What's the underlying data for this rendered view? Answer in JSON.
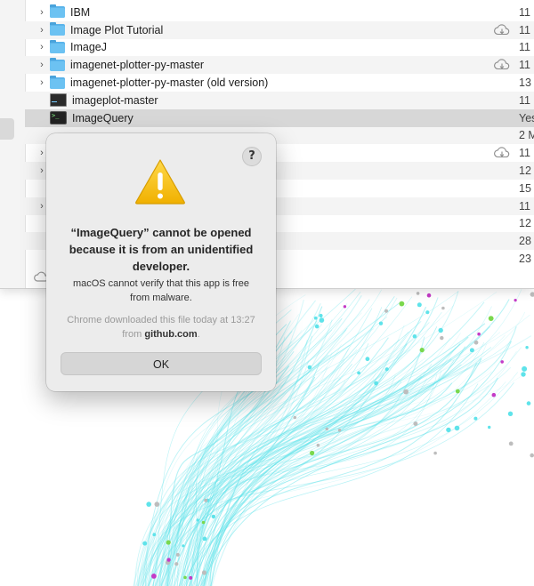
{
  "finder": {
    "rows": [
      {
        "name": "IBM",
        "icon": "folder-icon",
        "expandable": true,
        "cloud": false,
        "date": "11 I"
      },
      {
        "name": "Image Plot Tutorial",
        "icon": "folder-icon",
        "expandable": true,
        "cloud": true,
        "date": "11 I"
      },
      {
        "name": "ImageJ",
        "icon": "folder-icon",
        "expandable": true,
        "cloud": false,
        "date": "11 I"
      },
      {
        "name": "imagenet-plotter-py-master",
        "icon": "folder-icon",
        "expandable": true,
        "cloud": true,
        "date": "11 I"
      },
      {
        "name": "imagenet-plotter-py-master (old version)",
        "icon": "folder-icon",
        "expandable": true,
        "cloud": false,
        "date": "13"
      },
      {
        "name": "imageplot-master",
        "icon": "folder-icon",
        "expandable": false,
        "cloud": false,
        "date": "11 I"
      },
      {
        "name": "ImageQuery",
        "icon": "terminal-app-icon",
        "expandable": false,
        "cloud": false,
        "date": "Yes",
        "selected": true
      },
      {
        "name": "",
        "icon": "",
        "expandable": false,
        "cloud": false,
        "date": "2 M"
      },
      {
        "name": "",
        "icon": "",
        "expandable": true,
        "cloud": true,
        "date": "11 I"
      },
      {
        "name": "",
        "icon": "",
        "expandable": true,
        "cloud": false,
        "date": "12"
      },
      {
        "name": "",
        "icon": "",
        "expandable": false,
        "cloud": false,
        "date": "15"
      },
      {
        "name": "",
        "icon": "",
        "expandable": true,
        "cloud": false,
        "date": "11 I"
      },
      {
        "name": "",
        "icon": "",
        "expandable": false,
        "cloud": false,
        "date": "12"
      },
      {
        "name": "",
        "icon": "",
        "expandable": false,
        "cloud": false,
        "date": "28"
      },
      {
        "name": "",
        "icon": "",
        "expandable": false,
        "cloud": false,
        "date": "23"
      }
    ]
  },
  "alert": {
    "help_label": "?",
    "icon": "warning-triangle-icon",
    "title": "“ImageQuery” cannot be opened because it is from an unidentified developer.",
    "body": "macOS cannot verify that this app is free from malware.",
    "note_prefix": "Chrome downloaded this file today at 13:27 from ",
    "note_source": "github.com",
    "note_suffix": ".",
    "ok_label": "OK"
  },
  "colors": {
    "accent_cyan": "#5fe3ea",
    "folder_blue": "#5bb4ea",
    "warning_yellow": "#f5c41c",
    "dialog_bg": "#ececec"
  }
}
